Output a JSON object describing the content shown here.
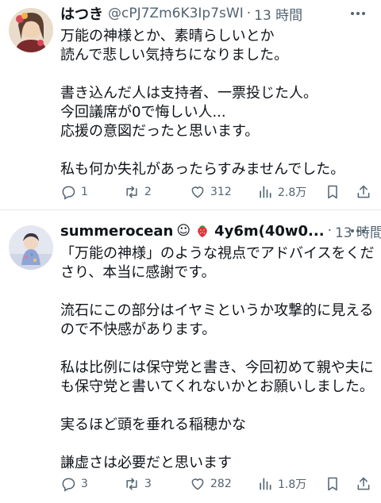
{
  "colors": {
    "text": "#0f1419",
    "secondary": "#536471",
    "divider": "#e6e9ec"
  },
  "posts": [
    {
      "name": "はつき",
      "handle": "@cPJ7Zm6K3Ip7sWI",
      "separator": "·",
      "time": "13 時間",
      "body": "万能の神様とか、素晴らしいとか\n読んで悲しい気持ちになりました。\n\n書き込んだ人は支持者、一票投じた人。\n今回議席が0で悔しい人...\n応援の意図だったと思います。\n\n私も何か失礼があったらすみませんでした。",
      "replies": "1",
      "reposts": "2",
      "likes": "312",
      "views": "2.8万"
    },
    {
      "name": "summerocean",
      "name_emoji": "☺",
      "handle": "4y6m(40w0...",
      "separator": "·",
      "time": "13 時間",
      "body": "「万能の神様」のような視点でアドバイスをくださり、本当に感謝です。\n\n流石にこの部分はイヤミというか攻撃的に見えるので不快感があります。\n\n私は比例には保守党と書き、今回初めて親や夫にも保守党と書いてくれないかとお願いしました。\n\n実るほど頭を垂れる稲穂かな\n\n謙虚さは必要だと思います",
      "replies": "3",
      "reposts": "3",
      "likes": "282",
      "views": "1.8万"
    }
  ],
  "icons": {
    "more": "more-icon",
    "reply": "reply-icon",
    "repost": "repost-icon",
    "like": "heart-icon",
    "views": "views-icon",
    "bookmark": "bookmark-icon",
    "share": "share-icon",
    "strawberry": "strawberry-icon"
  }
}
